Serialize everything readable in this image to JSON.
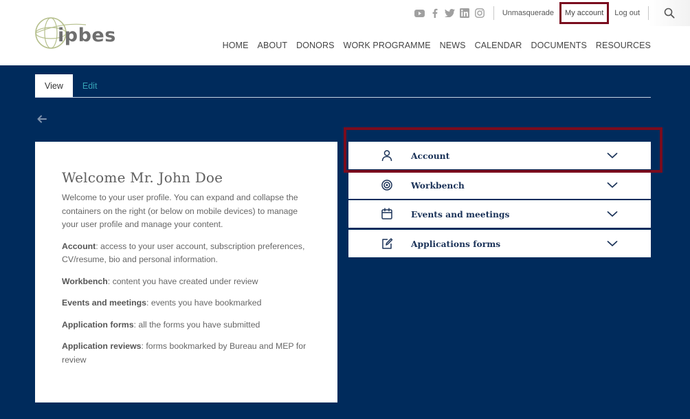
{
  "header": {
    "logo_text": "ipbes",
    "social_icons": [
      "youtube-icon",
      "facebook-icon",
      "twitter-icon",
      "linkedin-icon",
      "instagram-icon"
    ],
    "util_links": {
      "unmasquerade": "Unmasquerade",
      "my_account": "My account",
      "logout": "Log out"
    },
    "nav": [
      "HOME",
      "ABOUT",
      "DONORS",
      "WORK PROGRAMME",
      "NEWS",
      "CALENDAR",
      "DOCUMENTS",
      "RESOURCES"
    ]
  },
  "tabs": {
    "view": "View",
    "edit": "Edit"
  },
  "welcome": {
    "title": "Welcome Mr. John Doe",
    "intro": "Welcome to your user profile. You can expand and collapse the containers on the right (or below on mobile devices) to manage your user profile and manage your content.",
    "items": [
      {
        "term": "Account",
        "desc": ": access to your user account, subscription preferences, CV/resume, bio and personal information."
      },
      {
        "term": "Workbench",
        "desc": ": content you have created under review"
      },
      {
        "term": "Events and meetings",
        "desc": ": events you have bookmarked"
      },
      {
        "term": "Application forms",
        "desc": ": all the forms you have submitted"
      },
      {
        "term": "Application reviews",
        "desc": ": forms bookmarked by Bureau and MEP for review"
      }
    ]
  },
  "accordion": [
    {
      "label": "Account",
      "icon": "user-icon"
    },
    {
      "label": "Workbench",
      "icon": "target-icon"
    },
    {
      "label": "Events and meetings",
      "icon": "calendar-icon"
    },
    {
      "label": "Applications forms",
      "icon": "edit-icon"
    }
  ],
  "colors": {
    "primary_blue": "#002b5c",
    "highlight": "#7a0c1e",
    "tab_link": "#36a3b6"
  }
}
